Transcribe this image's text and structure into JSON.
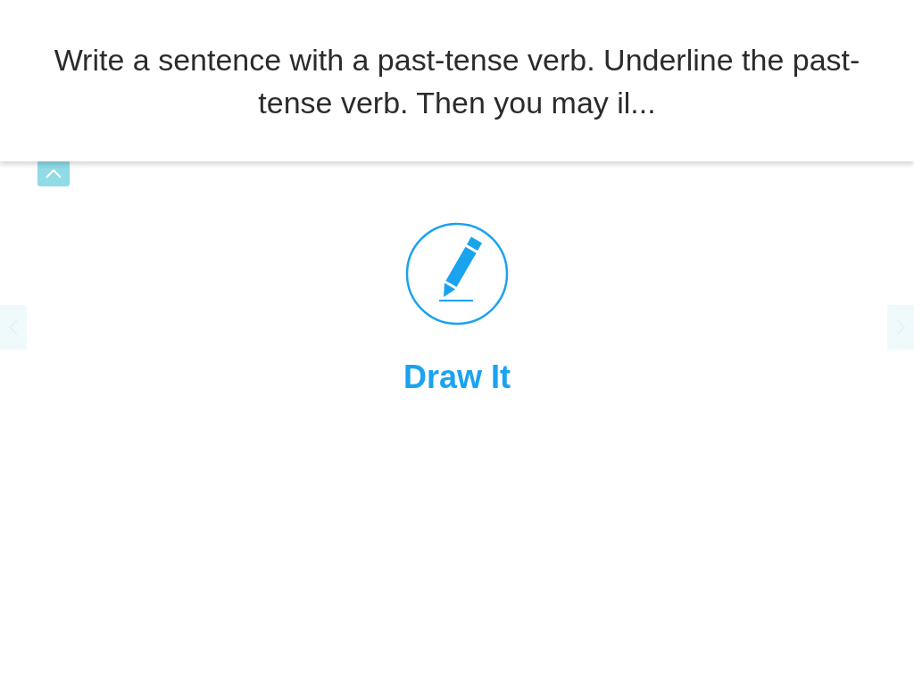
{
  "prompt": "Write a sentence with a past-tense verb. Underline the past-tense verb. Then you may il...",
  "collapse_button": {
    "expanded": true
  },
  "action": {
    "label": "Draw It"
  }
}
